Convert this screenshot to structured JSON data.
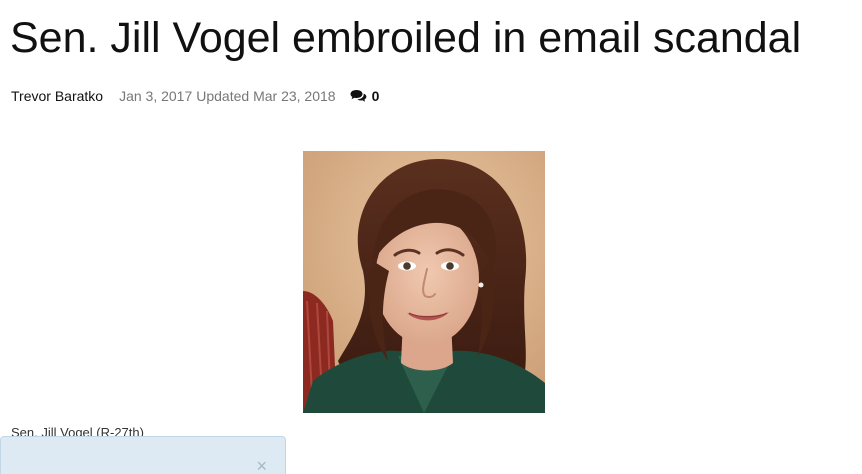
{
  "article": {
    "headline": "Sen. Jill Vogel embroiled in email scandal",
    "author": "Trevor Baratko",
    "published": "Jan 3, 2017",
    "updated": "Updated Mar 23, 2018",
    "comment_count": "0",
    "comment_icon": "comments-icon",
    "photo_alt": "Sen. Jill Vogel (R-27th)",
    "caption": "Sen. Jill Vogel (R-27th)"
  },
  "notification": {
    "close_label": "×",
    "close_icon": "close-icon"
  }
}
